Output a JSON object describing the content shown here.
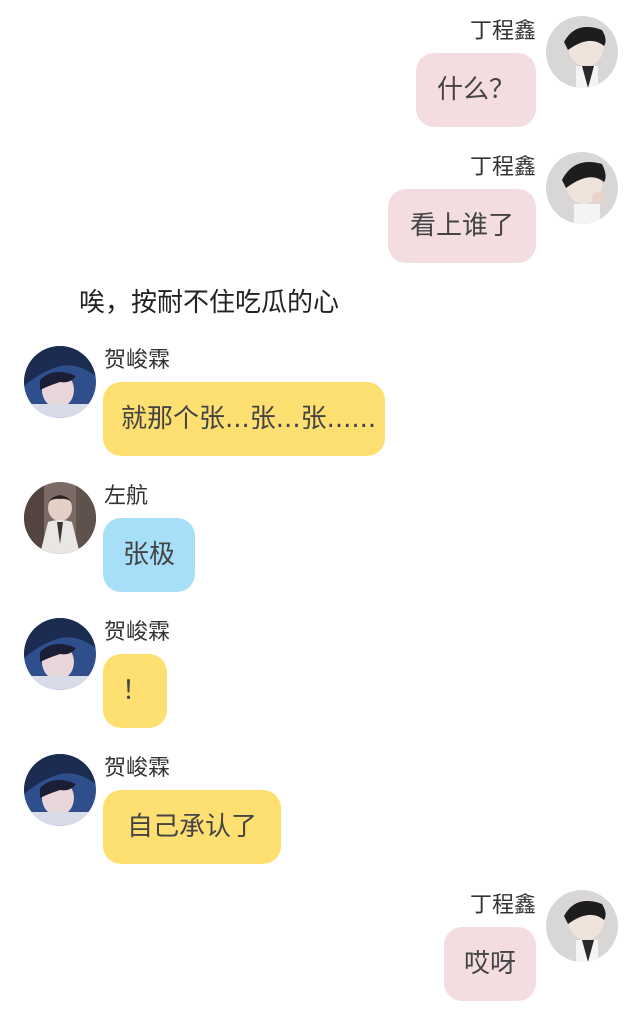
{
  "colors": {
    "pink_bubble": "#f4dde0",
    "yellow_bubble": "#fedf72",
    "blue_bubble": "#a7dff8"
  },
  "messages": [
    {
      "sender": "丁程鑫",
      "text": "什么？",
      "side": "right",
      "bubble_color": "pink"
    },
    {
      "sender": "丁程鑫",
      "text": "看上谁了",
      "side": "right",
      "bubble_color": "pink"
    },
    {
      "narration": "唉，按耐不住吃瓜的心"
    },
    {
      "sender": "贺峻霖",
      "text": "就那个张...张...张......",
      "side": "left",
      "bubble_color": "yellow"
    },
    {
      "sender": "左航",
      "text": "张极",
      "side": "left",
      "bubble_color": "blue"
    },
    {
      "sender": "贺峻霖",
      "text": "！",
      "side": "left",
      "bubble_color": "yellow"
    },
    {
      "sender": "贺峻霖",
      "text": "自己承认了",
      "side": "left",
      "bubble_color": "yellow"
    },
    {
      "sender": "丁程鑫",
      "text": "哎呀",
      "side": "right",
      "bubble_color": "pink"
    }
  ]
}
